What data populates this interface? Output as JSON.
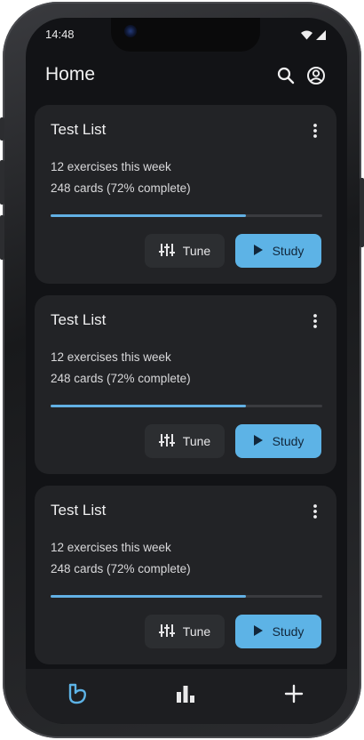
{
  "status_bar": {
    "time": "14:48",
    "icons": [
      "wifi-icon",
      "cellular-signal-icon"
    ]
  },
  "app_bar": {
    "title": "Home",
    "actions": [
      "search-icon",
      "account-circle-icon"
    ]
  },
  "cards": [
    {
      "title": "Test List",
      "line1": "12 exercises this week",
      "line2": "248 cards (72% complete)",
      "progress_percent": 72,
      "tune_label": "Tune",
      "study_label": "Study"
    },
    {
      "title": "Test List",
      "line1": "12 exercises this week",
      "line2": "248 cards (72% complete)",
      "progress_percent": 72,
      "tune_label": "Tune",
      "study_label": "Study"
    },
    {
      "title": "Test List",
      "line1": "12 exercises this week",
      "line2": "248 cards (72% complete)",
      "progress_percent": 72,
      "tune_label": "Tune",
      "study_label": "Study"
    }
  ],
  "bottom_nav": {
    "items": [
      "home-heart-icon",
      "stats-bar-icon",
      "add-icon"
    ],
    "active": "home-heart-icon"
  },
  "colors": {
    "accent": "#5db3e6",
    "background": "#121316",
    "card": "#222326"
  }
}
